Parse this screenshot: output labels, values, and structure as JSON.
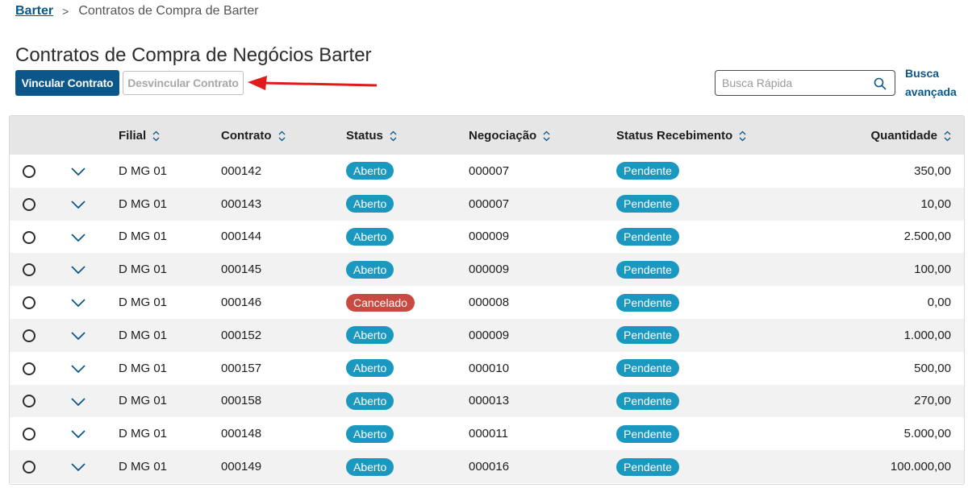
{
  "breadcrumb": {
    "root": "Barter",
    "separator": ">",
    "current": "Contratos de Compra de Barter"
  },
  "page": {
    "title": "Contratos de Compra de Negócios Barter"
  },
  "actions": {
    "link_label": "Vincular Contrato",
    "unlink_label": "Desvincular Contrato"
  },
  "search": {
    "placeholder": "Busca Rápida",
    "advanced_line1": "Busca",
    "advanced_line2": "avançada"
  },
  "colors": {
    "primary": "#0c5789",
    "badge_open": "#1a98c0",
    "badge_cancel": "#c94a40",
    "annotation_arrow": "#e01b1b"
  },
  "table": {
    "columns": [
      "Filial",
      "Contrato",
      "Status",
      "Negociação",
      "Status Recebimento",
      "Quantidade"
    ],
    "rows": [
      {
        "filial": "D MG 01",
        "contrato": "000142",
        "status": "Aberto",
        "negociacao": "000007",
        "status_recebimento": "Pendente",
        "quantidade": "350,00"
      },
      {
        "filial": "D MG 01",
        "contrato": "000143",
        "status": "Aberto",
        "negociacao": "000007",
        "status_recebimento": "Pendente",
        "quantidade": "10,00"
      },
      {
        "filial": "D MG 01",
        "contrato": "000144",
        "status": "Aberto",
        "negociacao": "000009",
        "status_recebimento": "Pendente",
        "quantidade": "2.500,00"
      },
      {
        "filial": "D MG 01",
        "contrato": "000145",
        "status": "Aberto",
        "negociacao": "000009",
        "status_recebimento": "Pendente",
        "quantidade": "100,00"
      },
      {
        "filial": "D MG 01",
        "contrato": "000146",
        "status": "Cancelado",
        "negociacao": "000008",
        "status_recebimento": "Pendente",
        "quantidade": "0,00"
      },
      {
        "filial": "D MG 01",
        "contrato": "000152",
        "status": "Aberto",
        "negociacao": "000009",
        "status_recebimento": "Pendente",
        "quantidade": "1.000,00"
      },
      {
        "filial": "D MG 01",
        "contrato": "000157",
        "status": "Aberto",
        "negociacao": "000010",
        "status_recebimento": "Pendente",
        "quantidade": "500,00"
      },
      {
        "filial": "D MG 01",
        "contrato": "000158",
        "status": "Aberto",
        "negociacao": "000013",
        "status_recebimento": "Pendente",
        "quantidade": "270,00"
      },
      {
        "filial": "D MG 01",
        "contrato": "000148",
        "status": "Aberto",
        "negociacao": "000011",
        "status_recebimento": "Pendente",
        "quantidade": "5.000,00"
      },
      {
        "filial": "D MG 01",
        "contrato": "000149",
        "status": "Aberto",
        "negociacao": "000016",
        "status_recebimento": "Pendente",
        "quantidade": "100.000,00"
      }
    ]
  }
}
